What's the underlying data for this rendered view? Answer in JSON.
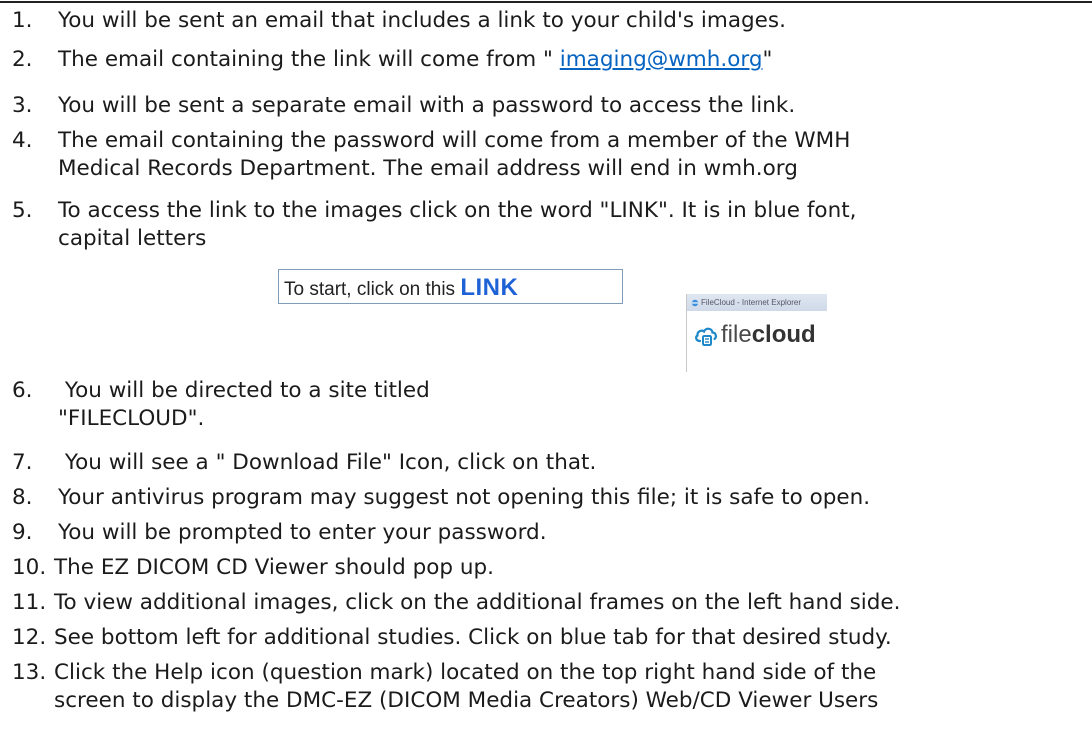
{
  "steps": [
    {
      "number": "1.",
      "text": "You will be sent an email that includes a link to your child's images."
    },
    {
      "number": "2.",
      "text_before": "The email containing the link will come from \" ",
      "link": "imaging@wmh.org",
      "text_after": "\""
    },
    {
      "number": "3.",
      "text": "You will be sent a separate email with a password to access the link."
    },
    {
      "number": "4.",
      "line1": "The email containing the password will come from a member of the WMH",
      "line2": "Medical Records Department.  The email address will end in wmh.org"
    },
    {
      "number": "5.",
      "line1": "To access the link to the images click on the word \"LINK\".  It is in blue font,",
      "line2": "capital letters"
    },
    {
      "number": "6.",
      "line1": " You will be directed to a site titled",
      "line2": "\"FILECLOUD\"."
    },
    {
      "number": "7.",
      "text": " You will see a \" Download File\" Icon, click on that."
    },
    {
      "number": "8.",
      "text": "Your antivirus program may suggest not opening this file; it is safe to open."
    },
    {
      "number": "9.",
      "text": "You will be prompted to enter your password."
    },
    {
      "number": "10.",
      "text": "The EZ DICOM CD Viewer should pop up."
    },
    {
      "number": "11.",
      "text": "To view additional images, click on the additional frames on the left hand side."
    },
    {
      "number": "12.",
      "text": "See bottom left for additional studies. Click on blue tab for that desired study."
    },
    {
      "number": "13.",
      "line1": "Click the Help icon (question mark) located on the top right hand side of the",
      "line2": "screen to display the DMC-EZ (DICOM Media Creators) Web/CD Viewer Users"
    }
  ],
  "link_sample": {
    "prefix": "To start, click on this ",
    "link_word": "LINK"
  },
  "filecloud_window": {
    "title": "FileCloud - Internet Explorer",
    "brand_regular": "file",
    "brand_bold": "cloud"
  },
  "colors": {
    "link": "#0563c1",
    "link_word": "#1f62d6"
  }
}
